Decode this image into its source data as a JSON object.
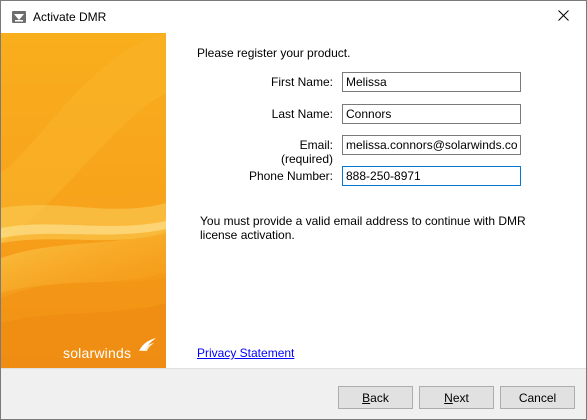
{
  "window": {
    "title": "Activate DMR",
    "icon": "app-icon"
  },
  "brand": {
    "name": "solarwinds",
    "color": "#f7a21b"
  },
  "form": {
    "intro": "Please register your product.",
    "first_name": {
      "label": "First Name:",
      "value": "Melissa"
    },
    "last_name": {
      "label": "Last Name:",
      "value": "Connors"
    },
    "email": {
      "label": "Email:",
      "sublabel": "(required)",
      "value": "melissa.connors@solarwinds.com"
    },
    "phone": {
      "label": "Phone Number:",
      "value": "888-250-8971"
    },
    "notice": "You must provide a valid email address to continue with DMR license activation.",
    "privacy_link": "Privacy Statement"
  },
  "footer": {
    "back": {
      "mnemonic": "B",
      "rest": "ack"
    },
    "next": {
      "mnemonic": "N",
      "rest": "ext"
    },
    "cancel": {
      "label": "Cancel"
    }
  }
}
